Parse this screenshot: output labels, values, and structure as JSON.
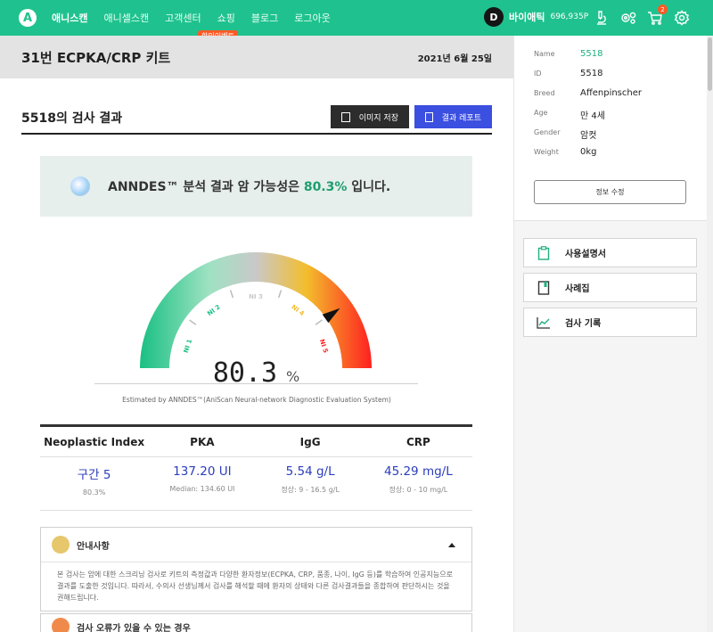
{
  "topbar": {
    "logo": "A",
    "nav": [
      "애니스캔",
      "애니셀스캔",
      "고객센터",
      "쇼핑",
      "블로그",
      "로그아웃"
    ],
    "sale_badge": "할인이벤트",
    "user": {
      "initial": "D",
      "name": "바이애틱",
      "points": "696,935P"
    },
    "cart_count": "2",
    "icons": [
      "microscope-icon",
      "gears-icon",
      "cart-icon",
      "settings-icon"
    ]
  },
  "kit": {
    "title": "31번 ECPKA/CRP 키트",
    "date": "2021년 6월 25일"
  },
  "result": {
    "title": "5518의 검사 결과",
    "save_label": "이미지 저장",
    "report_label": "결과 레포트"
  },
  "banner": {
    "prefix": "ANNDES™ 분석 결과 암 가능성은 ",
    "percent": "80.3%",
    "suffix": " 입니다."
  },
  "gauge": {
    "value": "80.3",
    "unit": "%",
    "value_fraction": 0.803,
    "labels": [
      "NI 1",
      "NI 2",
      "NI 3",
      "NI 4",
      "NI 5"
    ],
    "colors": {
      "low": "#19c083",
      "mid": "#c9c9c9",
      "high": "#f3bd2c",
      "max": "#ff2020"
    }
  },
  "estimated": "Estimated by ANNDES™(AniScan Neural-network Diagnostic Evaluation System)",
  "stats": {
    "headers": [
      "Neoplastic Index",
      "PKA",
      "IgG",
      "CRP"
    ],
    "values": [
      "구간 5",
      "137.20 UI",
      "5.54 g/L",
      "45.29 mg/L"
    ],
    "subs": [
      "80.3%",
      "Median: 134.60 UI",
      "정상: 9 - 16.5 g/L",
      "정상: 0 - 10 mg/L"
    ]
  },
  "notice": {
    "title": "안내사항",
    "body": "본 검사는 암에 대한 스크리닝 검사로 키트의 측정값과 다양한 환자정보(ECPKA, CRP, 품종, 나이, IgG 등)를 학습하여 인공지능으로 결과를 도출한 것입니다. 따라서, 수의사 선생님께서 검사를 해석할 때에 환자의 상태와 다른 검사결과들을 종합하여 판단하시는 것을 권해드립니다.",
    "second_title": "검사 오류가 있을 수 있는 경우"
  },
  "patient": {
    "rows": [
      {
        "k": "Name",
        "v": "5518"
      },
      {
        "k": "ID",
        "v": "5518"
      },
      {
        "k": "Breed",
        "v": "Affenpinscher"
      },
      {
        "k": "Age",
        "v": "만 4세"
      },
      {
        "k": "Gender",
        "v": "암컷"
      },
      {
        "k": "Weight",
        "v": "0kg"
      }
    ],
    "edit_label": "정보 수정"
  },
  "side_menu": [
    {
      "label": "사용설명서",
      "icon": "clipboard-icon"
    },
    {
      "label": "사례집",
      "icon": "book-icon"
    },
    {
      "label": "검사 기록",
      "icon": "chart-line-icon"
    }
  ],
  "accent": "#1fc28e"
}
